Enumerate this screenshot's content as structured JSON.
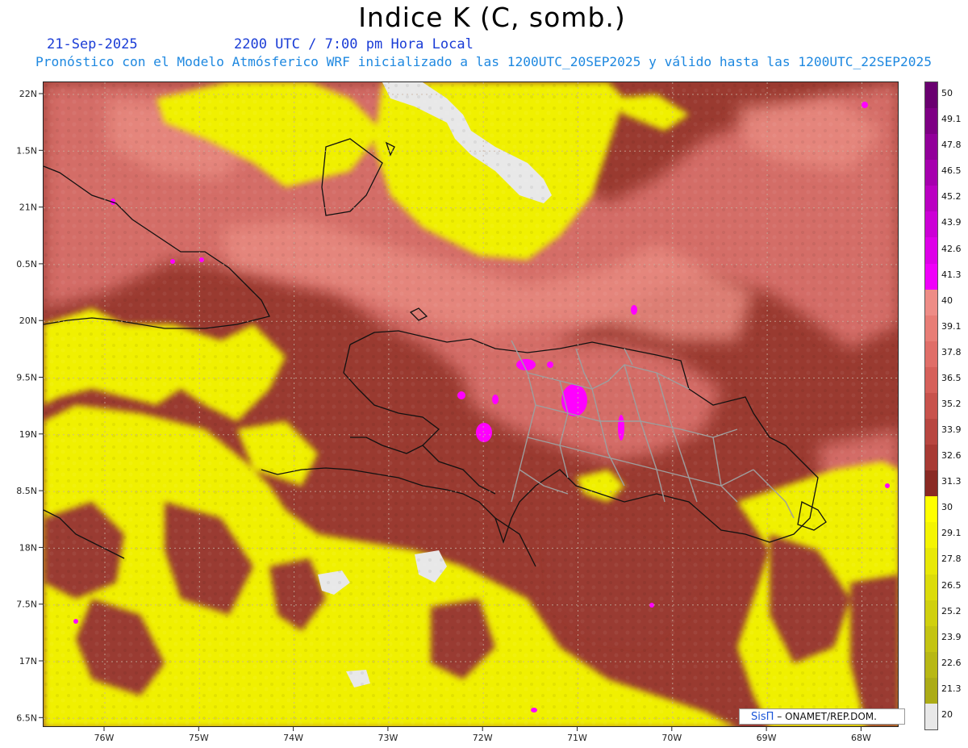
{
  "title": "Indice K (C, somb.)",
  "date": "21-Sep-2025",
  "time": "2200 UTC / 7:00 pm Hora Local",
  "description": "Pronóstico con el Modelo Atmósferico WRF inicializado a las 1200UTC_20SEP2025 y válido hasta las  1200UTC_22SEP2025",
  "credit": {
    "logo": "SisΠ",
    "text": "– ONAMET/REP.DOM."
  },
  "axes": {
    "x_labels": [
      "76W",
      "75W",
      "74W",
      "73W",
      "72W",
      "71W",
      "70W",
      "69W",
      "68W"
    ],
    "y_labels": [
      "22N",
      "1.5N",
      "21N",
      "0.5N",
      "20N",
      "9.5N",
      "19N",
      "8.5N",
      "18N",
      "7.5N",
      "17N",
      "6.5N"
    ]
  },
  "colorbar": {
    "labels": [
      "50",
      "49.1",
      "47.8",
      "46.5",
      "45.2",
      "43.9",
      "42.6",
      "41.3",
      "40",
      "39.1",
      "37.8",
      "36.5",
      "35.2",
      "33.9",
      "32.6",
      "31.3",
      "30",
      "29.1",
      "27.8",
      "26.5",
      "25.2",
      "23.9",
      "22.6",
      "21.3",
      "20"
    ],
    "colors": [
      "#6a0070",
      "#7e0084",
      "#92009a",
      "#a600ae",
      "#ba00c2",
      "#cc00d6",
      "#de00e8",
      "#f000fa",
      "#ee8c86",
      "#e87d76",
      "#e06e68",
      "#d6605a",
      "#c8524c",
      "#b84640",
      "#a83a34",
      "#8a2a24",
      "#ffff00",
      "#f4f402",
      "#e8e806",
      "#dcdc0a",
      "#d0d00e",
      "#c4c412",
      "#b8b814",
      "#acac16",
      "#e8e8e8"
    ]
  },
  "legend_colors": {
    "yellow": "#f0f000",
    "brown": "#9a3a30",
    "pink": "#d8706a",
    "magenta": "#ff00ff",
    "gray": "#e8e8e8"
  }
}
